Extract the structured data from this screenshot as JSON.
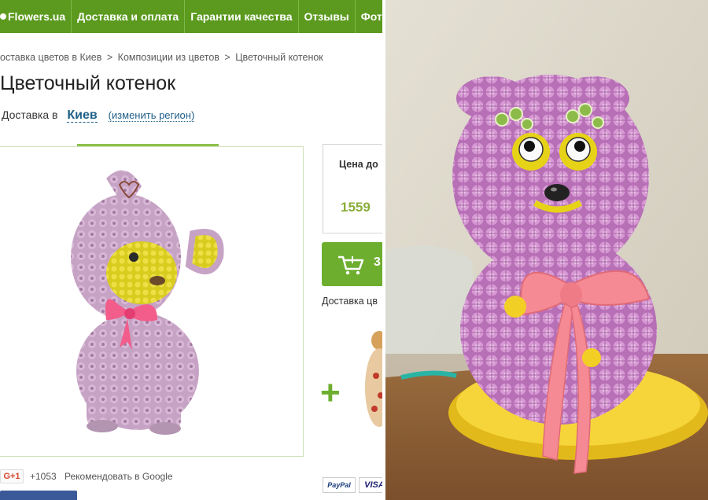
{
  "nav": {
    "items": [
      "Flowers.ua",
      "Доставка и оплата",
      "Гарантии качества",
      "Отзывы",
      "Фотоо"
    ]
  },
  "breadcrumb": {
    "items": [
      "оставка цветов в Киев",
      "Композиции из цветов",
      "Цветочный котенок"
    ],
    "separator": ">"
  },
  "product": {
    "title": "Цветочный котенок"
  },
  "delivery": {
    "label": "Доставка в",
    "city": "Киев",
    "change_region": "(изменить регион)"
  },
  "price": {
    "label": "Цена до",
    "value": "1559"
  },
  "cart": {
    "digit": "3"
  },
  "delivery_note": "Доставка цв",
  "social": {
    "gplus_label": "G+1",
    "gplus_count": "+1053",
    "recommend_text": "Рекомендовать в Google"
  },
  "payment": {
    "paypal": "PayPal",
    "visa": "VISA"
  },
  "colors": {
    "nav_green": "#5b9a1e",
    "accent_green": "#6dae2f",
    "price_green": "#8aad3a",
    "link_blue": "#1f5f88",
    "flower_pink": "#c98ac5",
    "ribbon_pink": "#f58a94",
    "tray_yellow": "#f5d53a"
  },
  "icons": [
    "cart-icon"
  ]
}
